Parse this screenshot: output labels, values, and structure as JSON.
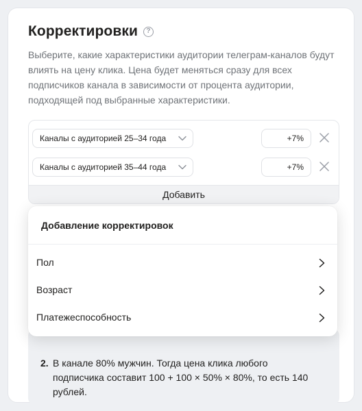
{
  "section": {
    "title": "Корректировки",
    "help_icon": "question-circle-icon",
    "description": "Выберите, какие характеристики аудитории телеграм-каналов будут влиять на цену клика. Цена будет меняться сразу для всех подписчиков канала в зависимости от процента аудитории, подходящей под выбранные характеристики."
  },
  "adjustments": [
    {
      "audience": "Каналы с аудиторией 25–34 года",
      "percent": "+7%"
    },
    {
      "audience": "Каналы с аудиторией 35–44 года",
      "percent": "+7%"
    }
  ],
  "add_button": "Добавить",
  "dropdown": {
    "title": "Добавление корректировок",
    "items": [
      {
        "label": "Пол"
      },
      {
        "label": "Возраст"
      },
      {
        "label": "Платежеспособность"
      }
    ]
  },
  "example": {
    "item_number": "2.",
    "text": "В канале 80% мужчин. Тогда цена клика любого подписчика составит 100 + 100 × 50% × 80%, то есть 140 рублей."
  },
  "colors": {
    "background": "#eef0f3",
    "text": "#21201f",
    "muted_text": "#6f7378"
  }
}
